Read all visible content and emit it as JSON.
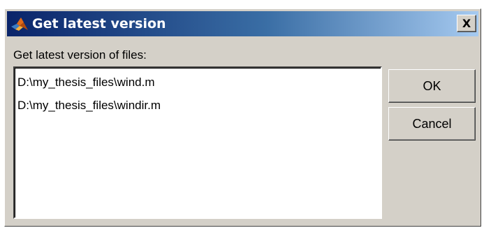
{
  "window": {
    "title": "Get latest version",
    "app_icon": "matlab-logo-icon",
    "close_label": "X"
  },
  "prompt": {
    "label": "Get latest version of files:"
  },
  "files": [
    "D:\\my_thesis_files\\wind.m",
    "D:\\my_thesis_files\\windir.m"
  ],
  "buttons": {
    "ok_label": "OK",
    "cancel_label": "Cancel"
  },
  "colors": {
    "titlebar_start": "#0a246a",
    "titlebar_end": "#a6caf0",
    "dialog_face": "#d4d0c8"
  }
}
